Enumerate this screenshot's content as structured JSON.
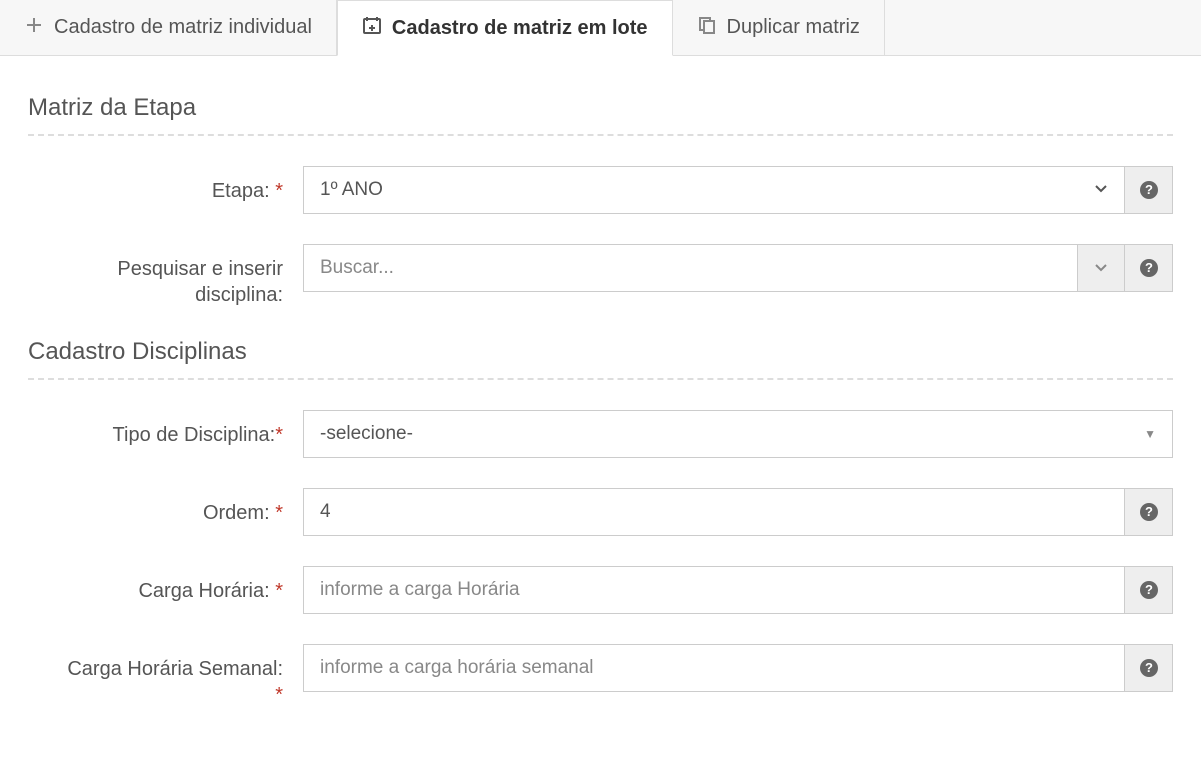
{
  "tabs": {
    "individual": "Cadastro de matriz individual",
    "lote": "Cadastro de matriz em lote",
    "duplicar": "Duplicar matriz"
  },
  "sections": {
    "matriz": "Matriz da Etapa",
    "disciplinas": "Cadastro Disciplinas"
  },
  "labels": {
    "etapa": "Etapa:",
    "pesquisar": "Pesquisar e inserir disciplina:",
    "tipo": "Tipo de Disciplina:",
    "ordem": "Ordem:",
    "carga": "Carga Horária:",
    "carga_semanal": "Carga Horária Semanal:"
  },
  "required_marker": "*",
  "values": {
    "etapa": "1º ANO",
    "tipo": "-selecione-",
    "ordem": "4"
  },
  "placeholders": {
    "buscar": "Buscar...",
    "carga": "informe a carga Horária",
    "carga_semanal": "informe a carga horária semanal"
  }
}
